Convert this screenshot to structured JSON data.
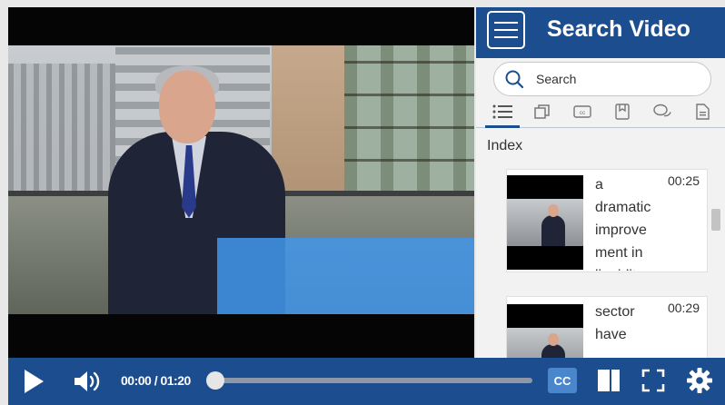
{
  "panel": {
    "title": "Search Video",
    "search_placeholder": "Search",
    "section_label": "Index",
    "tabs": [
      {
        "icon": "list-icon",
        "active": true
      },
      {
        "icon": "chapters-icon",
        "active": false
      },
      {
        "icon": "captions-icon",
        "active": false
      },
      {
        "icon": "bookmark-icon",
        "active": false
      },
      {
        "icon": "comments-icon",
        "active": false
      },
      {
        "icon": "notes-icon",
        "active": false
      }
    ],
    "index_items": [
      {
        "text": "a dramatic improvement in liquidity",
        "time": "00:25"
      },
      {
        "text": "sector have",
        "time": "00:29"
      }
    ]
  },
  "controls": {
    "time_display": "00:00 / 01:20",
    "progress": 0,
    "cc_label": "CC"
  },
  "colors": {
    "brand": "#1c4d8f",
    "cc_button": "#4a86cc",
    "overlay": "#4296eb"
  }
}
